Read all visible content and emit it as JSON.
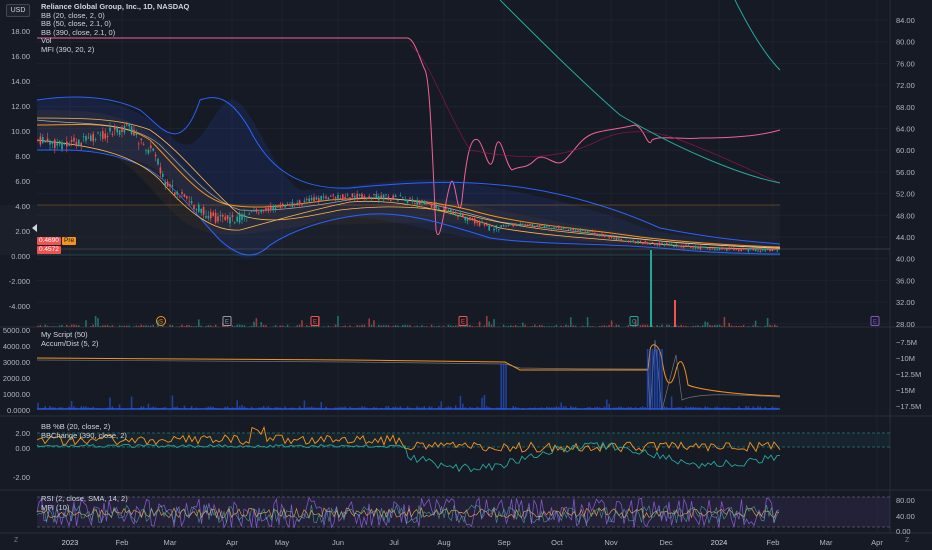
{
  "header": {
    "currency_button": "USD",
    "symbol_title": "Reliance Global Group, Inc., 1D, NASDAQ"
  },
  "main_legend": [
    "BB (20, close, 2, 0)",
    "BB (50, close, 2.1, 0)",
    "BB (390, close, 2.1, 0)",
    "Vol",
    "MFI (390, 20, 2)"
  ],
  "price_axis_left": [
    "18.00",
    "16.00",
    "14.00",
    "12.00",
    "10.00",
    "8.00",
    "6.00",
    "4.00",
    "2.00",
    "0.000",
    "-2.000",
    "-4.000"
  ],
  "price_axis_right": [
    "84.00",
    "80.00",
    "76.00",
    "72.00",
    "68.00",
    "64.00",
    "60.00",
    "56.00",
    "52.00",
    "48.00",
    "44.00",
    "40.00",
    "36.00",
    "32.00",
    "28.00"
  ],
  "price_badges": [
    "0.4690",
    "Pre",
    "0.4572"
  ],
  "event_markers": [
    "S",
    "E",
    "E",
    "E",
    "C",
    "E"
  ],
  "pane2_legend": [
    "My Script (50)",
    "Accum/Dist (5, 2)"
  ],
  "pane2_left_axis": [
    "5000.00",
    "4000.00",
    "3000.00",
    "2000.00",
    "1000.00",
    "0.0000"
  ],
  "pane2_right_axis": [
    "−7.5M",
    "−10M",
    "−12.5M",
    "−15M",
    "−17.5M"
  ],
  "pane3_legend": [
    "BB %B (20, close, 2)",
    "BBChange (390, close, 2)"
  ],
  "pane3_left_axis": [
    "2.00",
    "0.00",
    "-2.00"
  ],
  "pane4_legend": [
    "RSI (2, close, SMA, 14, 2)",
    "MFI (10)"
  ],
  "pane4_right_axis": [
    "80.00",
    "40.00",
    "0.00"
  ],
  "time_axis": [
    "2023",
    "Feb",
    "Mar",
    "Apr",
    "May",
    "Jun",
    "Jul",
    "Aug",
    "Sep",
    "Oct",
    "Nov",
    "Dec",
    "2024",
    "Feb",
    "Mar",
    "Apr"
  ],
  "corner_left": "Z",
  "corner_right": "Z",
  "colors": {
    "background": "#161a25",
    "bb_blue": "#2962ff",
    "bb_orange": "#f7931a",
    "mfi_pink": "#f06292",
    "mfi_green": "#26a69a",
    "candle_up": "#26a69a",
    "candle_down": "#ef5350",
    "rsi_purple": "#7e57c2"
  }
}
